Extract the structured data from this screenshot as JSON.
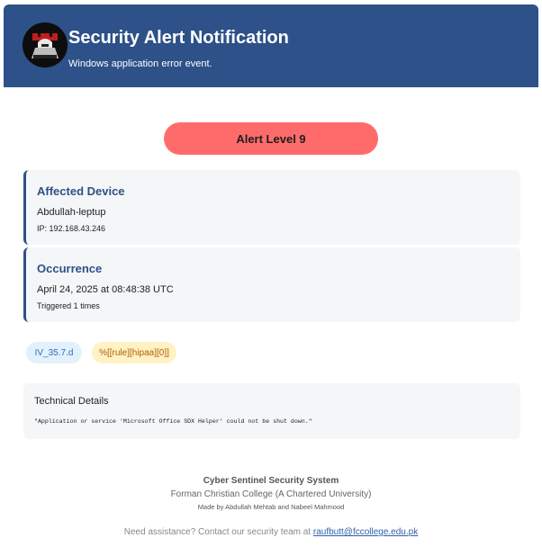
{
  "header": {
    "title": "Security Alert Notification",
    "subtitle": "Windows application error event.",
    "logo": "cyber-sentinel-knight-logo"
  },
  "alert": {
    "label": "Alert Level 9",
    "color": "#ff6b6b"
  },
  "affected_device": {
    "heading": "Affected Device",
    "name": "Abdullah-leptup",
    "ip": "IP: 192.168.43.246"
  },
  "occurrence": {
    "heading": "Occurrence",
    "datetime": "April 24, 2025 at 08:48:38 UTC",
    "count": "Triggered 1 times"
  },
  "tags": [
    {
      "label": "IV_35.7.d"
    },
    {
      "label": "%[[rule][hipaa][0]]"
    }
  ],
  "technical": {
    "heading": "Technical Details",
    "message": "\"Application or service 'Microsoft Office SDX Helper' could not be shut down.\""
  },
  "footer": {
    "org": "Cyber Sentinel Security System",
    "college": "Forman Christian College (A Chartered University)",
    "credit": "Made by Abdullah Mehtab and Nabeel Mahmood",
    "assist_prefix": "Need assistance? Contact our security team at ",
    "email": "raufbutt@fccollege.edu.pk"
  },
  "colors": {
    "header_bg": "#2d5188",
    "accent": "#2d5188",
    "card_bg": "#f5f6f8"
  }
}
